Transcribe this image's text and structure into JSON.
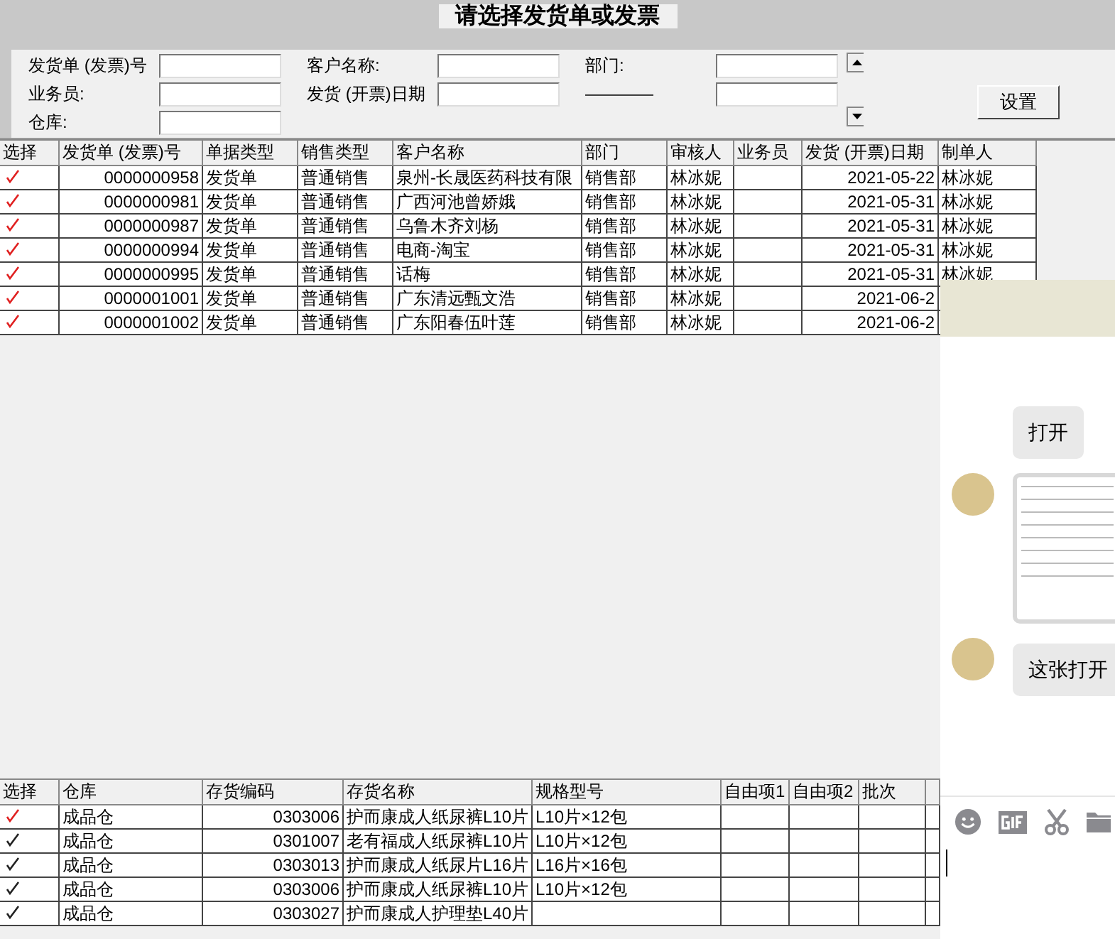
{
  "window": {
    "title": "请选择发货单或发票"
  },
  "filters": [
    {
      "label": "发货单 (发票)号"
    },
    {
      "label": "客户名称:"
    },
    {
      "label": "部门:"
    },
    {
      "label": "业务员:"
    },
    {
      "label": "发货 (开票)日期"
    },
    {
      "label": "————"
    },
    {
      "label": "仓库:"
    }
  ],
  "settings_button": "设置",
  "invoice_table": {
    "columns": [
      "选择",
      "发货单 (发票)号",
      "单据类型",
      "销售类型",
      "客户名称",
      "部门",
      "审核人",
      "业务员",
      "发货 (开票)日期",
      "制单人"
    ],
    "rows": [
      {
        "checked": true,
        "cells": [
          "",
          "0000000958",
          "发货单",
          "普通销售",
          "泉州-长晟医药科技有限",
          "销售部",
          "林冰妮",
          "",
          "2021-05-22",
          "林冰妮"
        ]
      },
      {
        "checked": true,
        "cells": [
          "",
          "0000000981",
          "发货单",
          "普通销售",
          "广西河池曾娇娥",
          "销售部",
          "林冰妮",
          "",
          "2021-05-31",
          "林冰妮"
        ]
      },
      {
        "checked": true,
        "cells": [
          "",
          "0000000987",
          "发货单",
          "普通销售",
          "乌鲁木齐刘杨",
          "销售部",
          "林冰妮",
          "",
          "2021-05-31",
          "林冰妮"
        ]
      },
      {
        "checked": true,
        "cells": [
          "",
          "0000000994",
          "发货单",
          "普通销售",
          "电商-淘宝",
          "销售部",
          "林冰妮",
          "",
          "2021-05-31",
          "林冰妮"
        ]
      },
      {
        "checked": true,
        "cells": [
          "",
          "0000000995",
          "发货单",
          "普通销售",
          "话梅",
          "销售部",
          "林冰妮",
          "",
          "2021-05-31",
          "林冰妮"
        ]
      },
      {
        "checked": true,
        "cells": [
          "",
          "0000001001",
          "发货单",
          "普通销售",
          "广东清远甄文浩",
          "销售部",
          "林冰妮",
          "",
          "2021-06-2",
          ""
        ]
      },
      {
        "checked": true,
        "cells": [
          "",
          "0000001002",
          "发货单",
          "普通销售",
          "广东阳春伍叶莲",
          "销售部",
          "林冰妮",
          "",
          "2021-06-2",
          ""
        ]
      }
    ]
  },
  "items_table": {
    "columns": [
      "选择",
      "仓库",
      "存货编码",
      "存货名称",
      "规格型号",
      "自由项1",
      "自由项2",
      "批次",
      ""
    ],
    "rows": [
      {
        "checked": true,
        "selected": true,
        "cells": [
          "",
          "成品仓",
          "0303006",
          "护而康成人纸尿裤L10片",
          "L10片×12包",
          "",
          "",
          "",
          ""
        ]
      },
      {
        "checked": true,
        "selected": false,
        "cells": [
          "",
          "成品仓",
          "0301007",
          "老有福成人纸尿裤L10片",
          "L10片×12包",
          "",
          "",
          "",
          ""
        ]
      },
      {
        "checked": true,
        "selected": false,
        "cells": [
          "",
          "成品仓",
          "0303013",
          "护而康成人纸尿片L16片",
          "L16片×16包",
          "",
          "",
          "",
          ""
        ]
      },
      {
        "checked": true,
        "selected": false,
        "cells": [
          "",
          "成品仓",
          "0303006",
          "护而康成人纸尿裤L10片",
          "L10片×12包",
          "",
          "",
          "",
          ""
        ]
      },
      {
        "checked": true,
        "selected": false,
        "cells": [
          "",
          "成品仓",
          "0303027",
          "护而康成人护理垫L40片",
          "",
          "",
          "",
          "",
          ""
        ]
      }
    ]
  },
  "chat": {
    "messages": [
      {
        "kind": "text",
        "avatar": false,
        "text": "打开"
      },
      {
        "kind": "image",
        "avatar": true
      },
      {
        "kind": "text",
        "avatar": true,
        "text": "这张打开"
      }
    ]
  }
}
